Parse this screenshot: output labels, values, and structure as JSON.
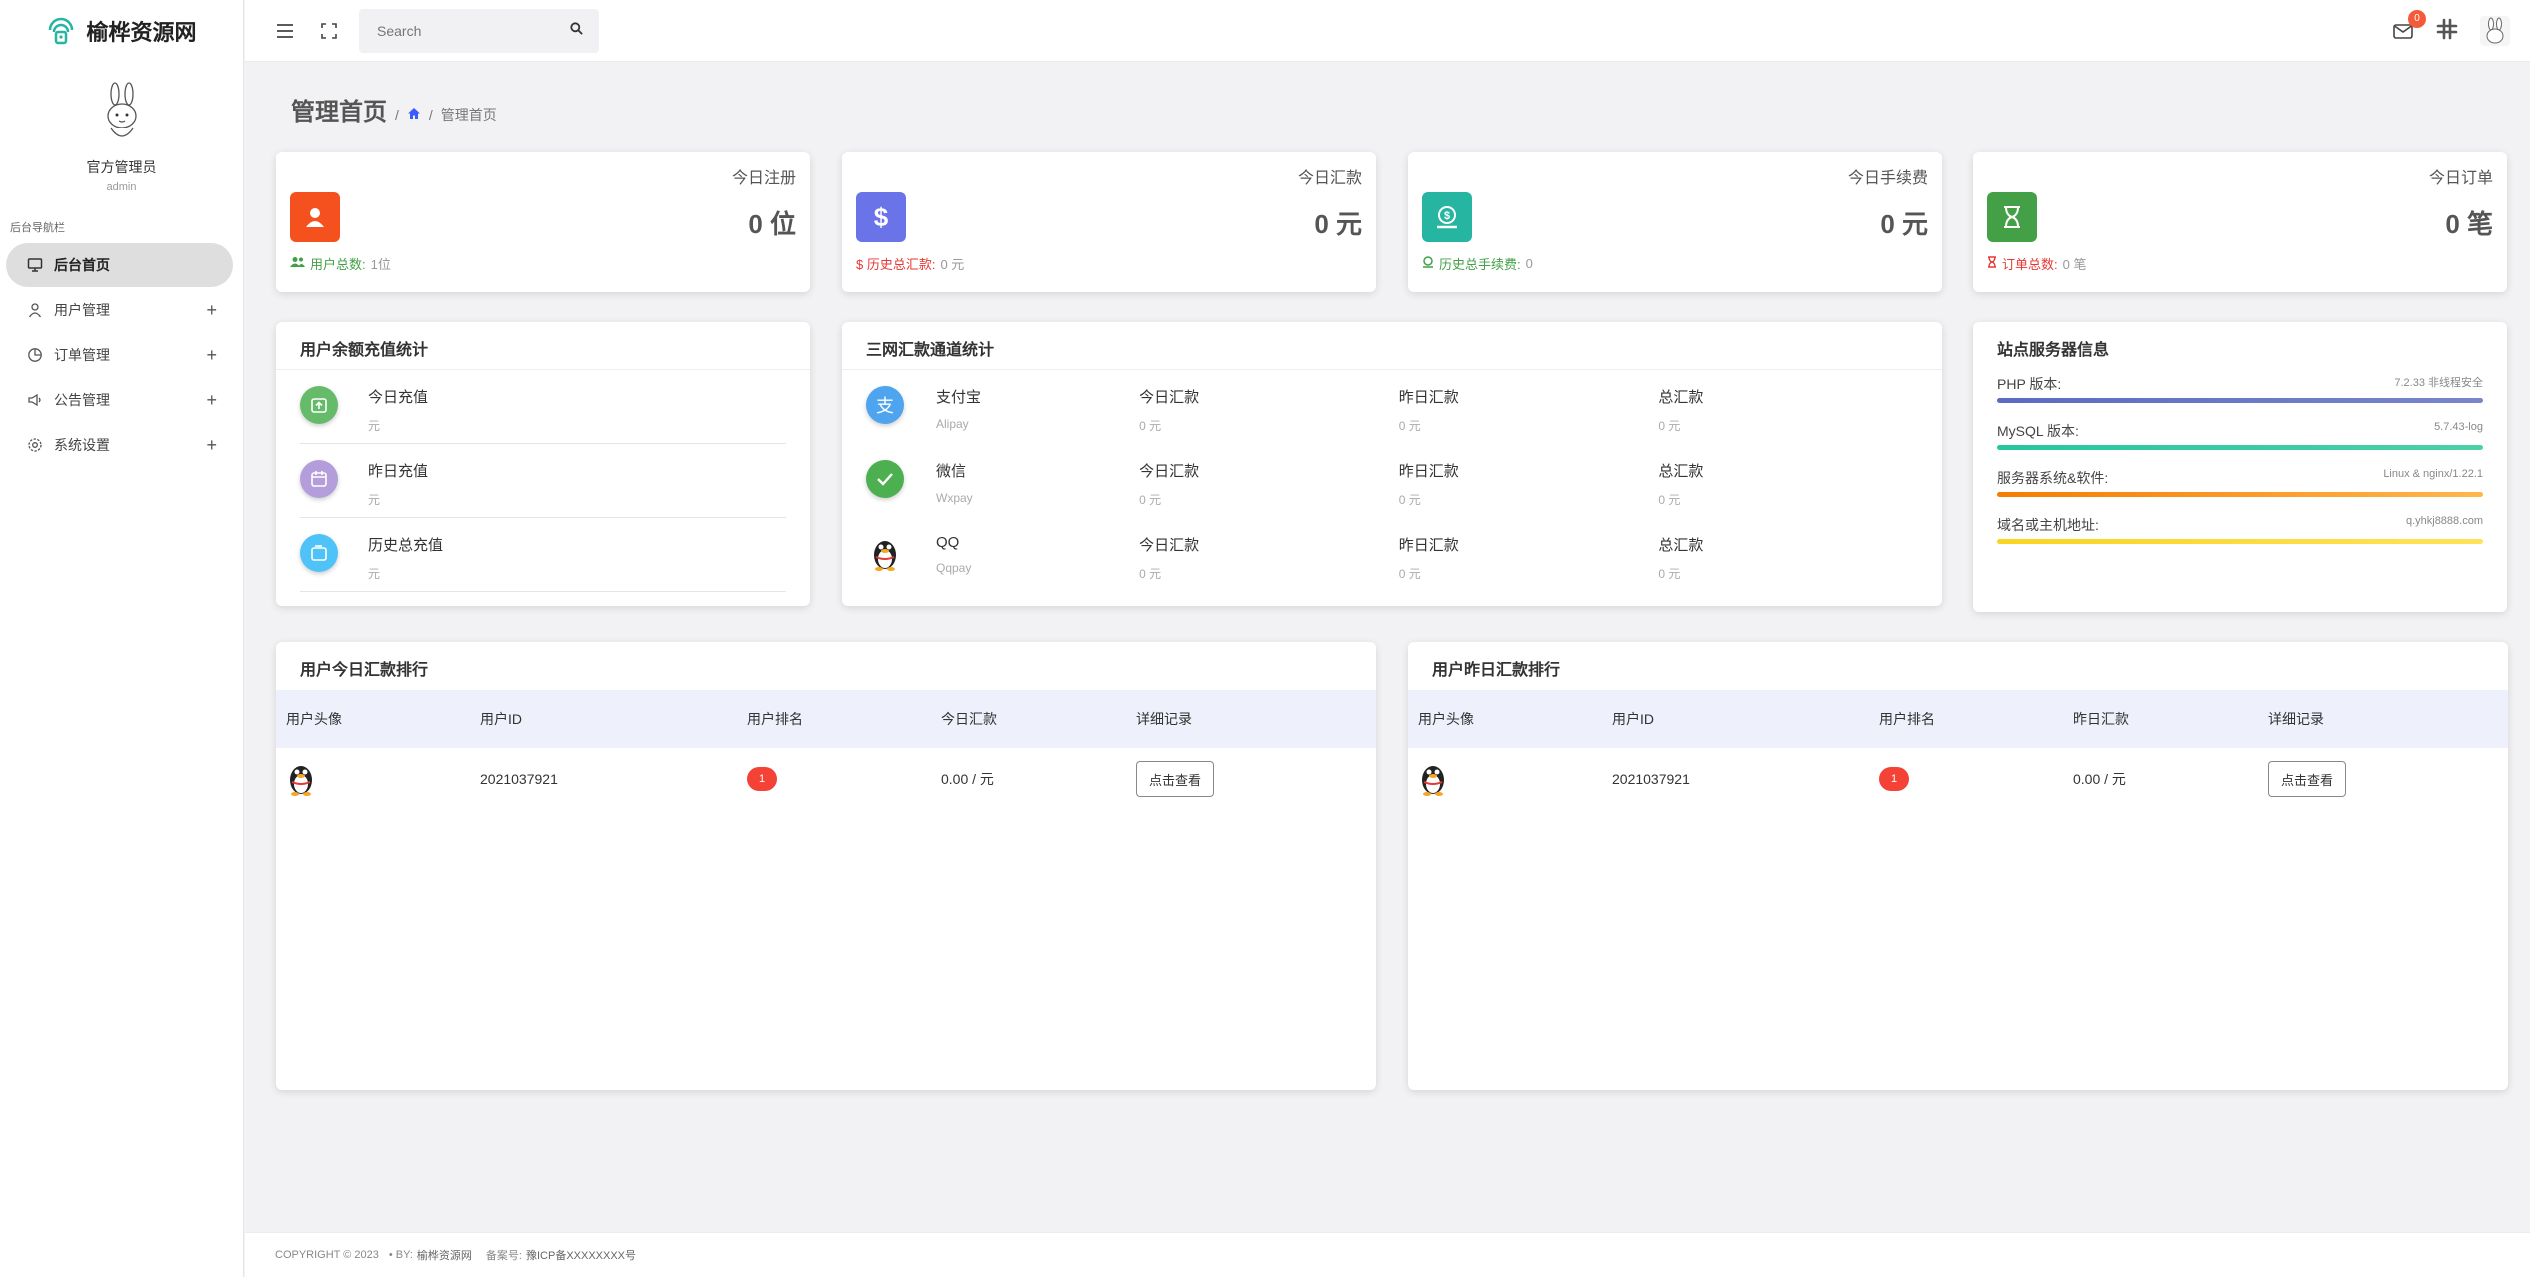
{
  "brand": {
    "name": "榆桦资源网"
  },
  "profile": {
    "name": "官方管理员",
    "role": "admin"
  },
  "nav": {
    "title": "后台导航栏",
    "items": [
      {
        "label": "后台首页",
        "icon": "monitor-icon",
        "active": true
      },
      {
        "label": "用户管理",
        "icon": "user-icon",
        "expand": "+"
      },
      {
        "label": "订单管理",
        "icon": "pie-chart-icon",
        "expand": "+"
      },
      {
        "label": "公告管理",
        "icon": "megaphone-icon",
        "expand": "+"
      },
      {
        "label": "系统设置",
        "icon": "gear-icon",
        "expand": "+"
      }
    ]
  },
  "header": {
    "search_placeholder": "Search",
    "mail_badge": "0"
  },
  "page": {
    "title": "管理首页",
    "sep": "/",
    "crumb": "管理首页"
  },
  "stats": [
    {
      "label": "今日注册",
      "value": "0 位",
      "foot_label": "用户总数:",
      "foot_value": "1位",
      "color": "#f4511e",
      "foot_color": "#43a047"
    },
    {
      "label": "今日汇款",
      "value": "0 元",
      "foot_label": "$ 历史总汇款:",
      "foot_value": "0 元",
      "color": "#6a73e8",
      "foot_color": "#e53935"
    },
    {
      "label": "今日手续费",
      "value": "0 元",
      "foot_label": "历史总手续费:",
      "foot_value": "0",
      "color": "#26b5a0",
      "foot_color": "#43a047"
    },
    {
      "label": "今日订单",
      "value": "0 笔",
      "foot_label": "订单总数:",
      "foot_value": "0 笔",
      "color": "#43a047",
      "foot_color": "#e53935"
    }
  ],
  "recharge": {
    "title": "用户余额充值统计",
    "rows": [
      {
        "name": "今日充值",
        "unit": "元",
        "color": "#66bb6a"
      },
      {
        "name": "昨日充值",
        "unit": "元",
        "color": "#b39ddb"
      },
      {
        "name": "历史总充值",
        "unit": "元",
        "color": "#4fc3f7"
      }
    ]
  },
  "channels": {
    "title": "三网汇款通道统计",
    "rows": [
      {
        "name": "支付宝",
        "sub": "Alipay",
        "c1": "今日汇款",
        "v1": "0 元",
        "c2": "昨日汇款",
        "v2": "0 元",
        "c3": "总汇款",
        "v3": "0 元",
        "color": "#4fa4f0"
      },
      {
        "name": "微信",
        "sub": "Wxpay",
        "c1": "今日汇款",
        "v1": "0 元",
        "c2": "昨日汇款",
        "v2": "0 元",
        "c3": "总汇款",
        "v3": "0 元",
        "color": "#4caf50"
      },
      {
        "name": "QQ",
        "sub": "Qqpay",
        "c1": "今日汇款",
        "v1": "0 元",
        "c2": "昨日汇款",
        "v2": "0 元",
        "c3": "总汇款",
        "v3": "0 元",
        "color": "#333333"
      }
    ]
  },
  "server": {
    "title": "站点服务器信息",
    "rows": [
      {
        "label": "PHP 版本:",
        "value": "7.2.33 非线程安全",
        "color": "#5c6bc0"
      },
      {
        "label": "MySQL 版本:",
        "value": "5.7.43-log",
        "color": "#26c6a0"
      },
      {
        "label": "服务器系统&软件:",
        "value": "Linux & nginx/1.22.1",
        "color": "#f59c3a"
      },
      {
        "label": "域名或主机地址:",
        "value": "q.yhkj8888.com",
        "color": "#f9d423"
      }
    ]
  },
  "today_rank": {
    "title": "用户今日汇款排行",
    "headers": [
      "用户头像",
      "用户ID",
      "用户排名",
      "今日汇款",
      "详细记录"
    ],
    "rows": [
      {
        "user_id": "2021037921",
        "rank": "1",
        "amount": "0.00 / 元",
        "button": "点击查看"
      }
    ]
  },
  "yesterday_rank": {
    "title": "用户昨日汇款排行",
    "headers": [
      "用户头像",
      "用户ID",
      "用户排名",
      "昨日汇款",
      "详细记录"
    ],
    "rows": [
      {
        "user_id": "2021037921",
        "rank": "1",
        "amount": "0.00 / 元",
        "button": "点击查看"
      }
    ]
  },
  "footer": {
    "copyright": "COPYRIGHT © 2023",
    "by_label": "• BY:",
    "by_value": "榆桦资源网",
    "icp_label": "备案号:",
    "icp_value": "豫ICP备XXXXXXXX号"
  }
}
